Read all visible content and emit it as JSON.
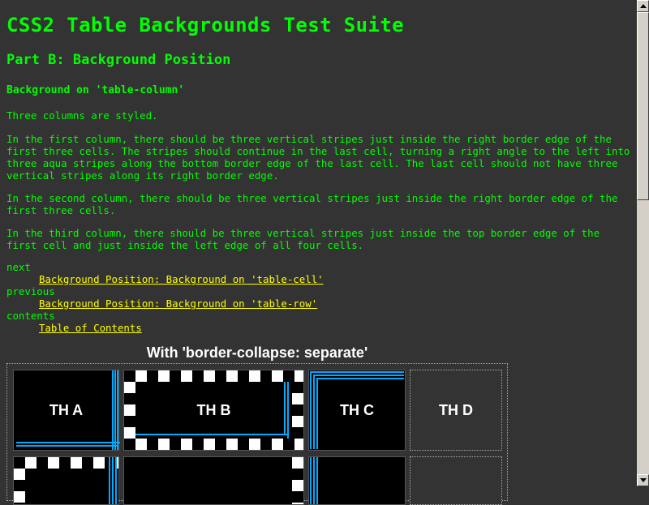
{
  "title": "CSS2 Table Backgrounds Test Suite",
  "part": "Part B: Background Position",
  "section": "Background on 'table-column'",
  "paragraphs": [
    "Three columns are styled.",
    "In the first column, there should be three vertical stripes just inside the right border edge of the first three cells. The stripes should continue in the last cell, turning a right angle to the left into three aqua stripes along the bottom border edge of the last cell. The last cell should not have three vertical stripes along its right border edge.",
    "In the second column, there should be three vertical stripes just inside the right border edge of the first three cells.",
    "In the third column, there should be three vertical stripes just inside the top border edge of the first cell and just inside the left edge of all four cells."
  ],
  "nav": {
    "next_label": "next",
    "next_link": "Background Position: Background on 'table-cell'",
    "previous_label": "previous",
    "previous_link": "Background Position: Background on 'table-row'",
    "contents_label": "contents",
    "contents_link": "Table of Contents"
  },
  "table": {
    "caption": "With 'border-collapse: separate'",
    "headers": [
      "TH A",
      "TH B",
      "TH C",
      "TH D"
    ]
  },
  "colors": {
    "background": "#333333",
    "text": "#00ff00",
    "link": "#ffff00",
    "stripe": "#00aaff"
  }
}
